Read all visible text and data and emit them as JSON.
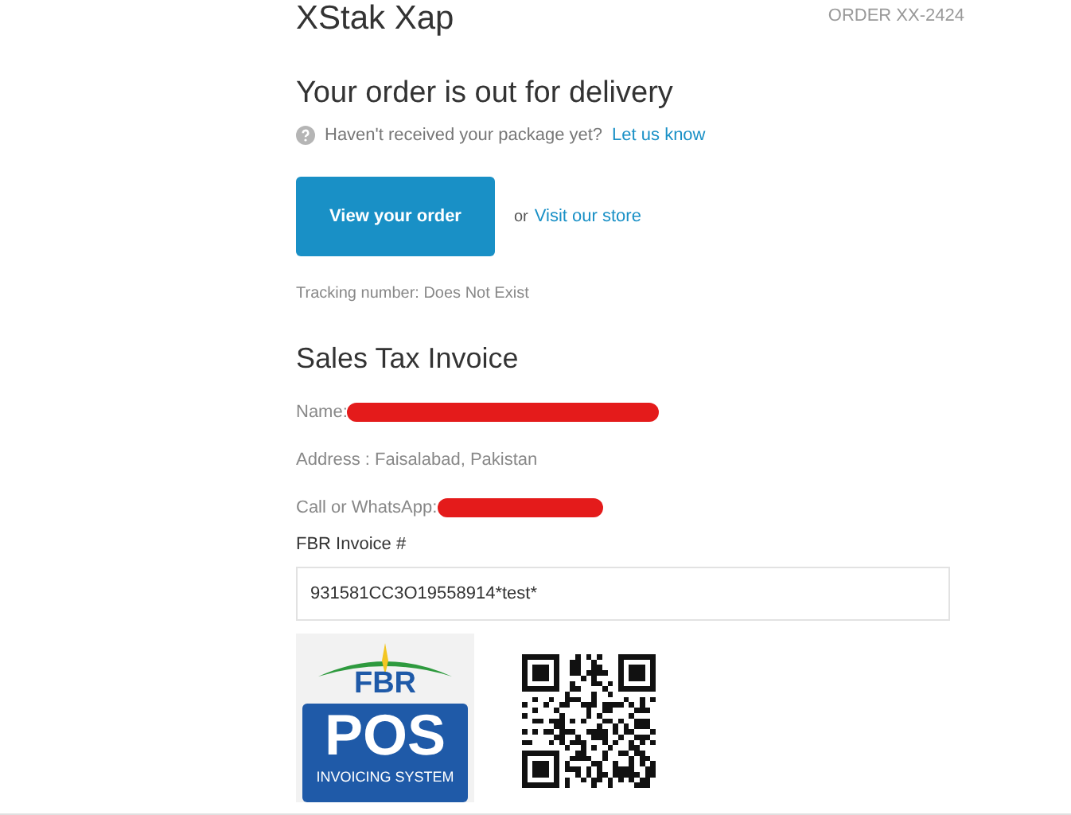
{
  "header": {
    "shop_name": "XStak Xap",
    "order_number": "ORDER XX-2424"
  },
  "status": {
    "heading": "Your order is out for delivery",
    "help_text": "Haven't received your package yet?",
    "help_link": "Let us know"
  },
  "actions": {
    "primary_button": "View your order",
    "separator": "or",
    "store_link": "Visit our store"
  },
  "tracking": "Tracking number: Does Not Exist",
  "invoice": {
    "heading": "Sales Tax Invoice",
    "fields": [
      {
        "label": "Name:",
        "redacted": true
      },
      {
        "label": "Address : Faisalabad, Pakistan",
        "redacted": false
      },
      {
        "label": "Call or WhatsApp:",
        "redacted": true
      }
    ],
    "fbr_label": "FBR Invoice #",
    "fbr_value": "931581CC3O19558914*test*",
    "logo": {
      "top": "FBR",
      "main": "POS",
      "sub": "INVOICING SYSTEM"
    }
  }
}
